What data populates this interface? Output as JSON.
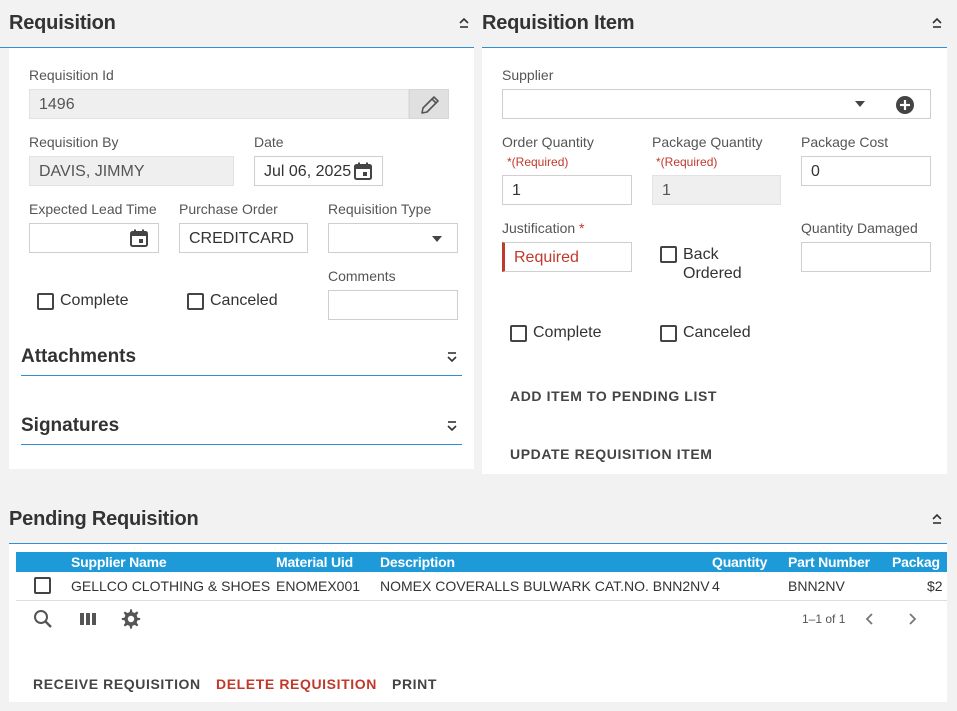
{
  "requisition": {
    "title": "Requisition",
    "id_label": "Requisition Id",
    "id_value": "1496",
    "by_label": "Requisition By",
    "by_value": "DAVIS, JIMMY",
    "date_label": "Date",
    "date_value": "Jul 06, 2025",
    "lead_time_label": "Expected Lead Time",
    "lead_time_value": "",
    "po_label": "Purchase Order",
    "po_value": "CREDITCARD",
    "type_label": "Requisition Type",
    "type_value": "",
    "comments_label": "Comments",
    "comments_value": "",
    "complete_label": "Complete",
    "canceled_label": "Canceled",
    "attachments_title": "Attachments",
    "signatures_title": "Signatures"
  },
  "item": {
    "title": "Requisition Item",
    "supplier_label": "Supplier",
    "supplier_value": "",
    "order_qty_label": "Order Quantity",
    "order_qty_required": "(Required)",
    "order_qty_value": "1",
    "pkg_qty_label": "Package Quantity",
    "pkg_qty_required": "(Required)",
    "pkg_qty_value": "1",
    "pkg_cost_label": "Package Cost",
    "pkg_cost_value": "0",
    "justification_label": "Justification",
    "justification_placeholder": "Required",
    "back_ordered_label_1": "Back",
    "back_ordered_label_2": "Ordered",
    "qty_damaged_label": "Quantity Damaged",
    "qty_damaged_value": "",
    "complete_label": "Complete",
    "canceled_label": "Canceled",
    "add_btn": "ADD ITEM TO PENDING LIST",
    "update_btn": "UPDATE REQUISITION ITEM"
  },
  "pending": {
    "title": "Pending Requisition",
    "columns": [
      "Supplier Name",
      "Material Uid",
      "Description",
      "Quantity",
      "Part Number",
      "Packag"
    ],
    "rows": [
      [
        "GELLCO CLOTHING & SHOES",
        "ENOMEX001",
        "NOMEX COVERALLS BULWARK CAT.NO. BNN2NV",
        "4",
        "BNN2NV",
        "$2"
      ]
    ],
    "pagination": "1–1 of 1",
    "receive_btn": "RECEIVE REQUISITION",
    "delete_btn": "DELETE REQUISITION",
    "print_btn": "PRINT"
  },
  "colors": {
    "accent": "#2f8fd1",
    "header_bg": "#1f9ad8",
    "error": "#c0392b"
  }
}
